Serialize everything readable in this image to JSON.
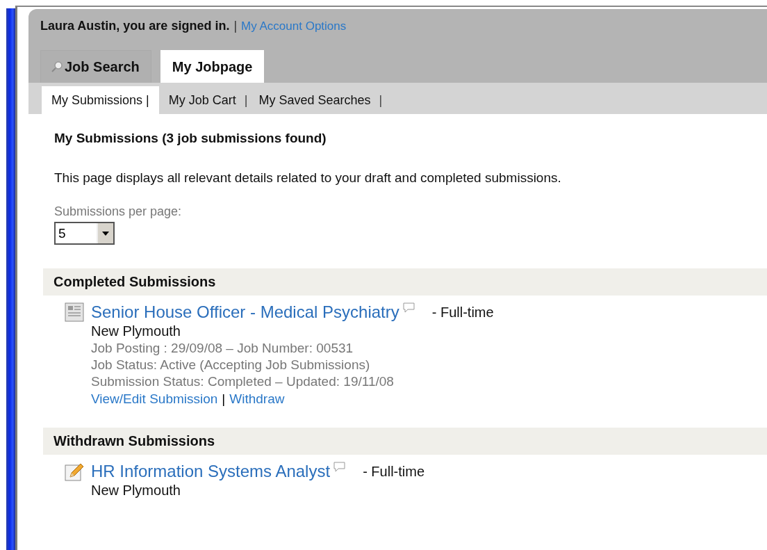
{
  "account": {
    "user_text": "Laura Austin, you are signed in.",
    "separator": "|",
    "link": "My Account Options"
  },
  "tabs": [
    {
      "label": "Job Search",
      "kind": "search",
      "selected": false
    },
    {
      "label": "My Jobpage",
      "kind": "plain",
      "selected": true
    }
  ],
  "subtabs": [
    {
      "label": "My Submissions",
      "separator": "|",
      "selected": true
    },
    {
      "label": "My Job Cart",
      "separator": "|",
      "selected": false
    },
    {
      "label": "My Saved Searches",
      "separator": "|",
      "selected": false
    }
  ],
  "heading": "My Submissions (3 job submissions found)",
  "intro": "This page displays all relevant details related to your draft and completed submissions.",
  "per_page": {
    "label": "Submissions per page:",
    "value": "5"
  },
  "sections": [
    {
      "title": "Completed Submissions",
      "jobs": [
        {
          "kind": "document",
          "title": "Senior House Officer - Medical Psychiatry",
          "type": "-  Full-time",
          "location": "New Plymouth",
          "details": [
            "Job Posting : 29/09/08 – Job Number: 00531",
            "Job Status: Active (Accepting Job Submissions)",
            "Submission Status: Completed – Updated: 19/11/08"
          ],
          "actions": [
            "View/Edit Submission",
            "Withdraw"
          ],
          "action_separator": "|"
        }
      ]
    },
    {
      "title": "Withdrawn Submissions",
      "jobs": [
        {
          "kind": "pencil",
          "title": "HR Information Systems Analyst",
          "type": "-  Full-time",
          "location": "New Plymouth"
        }
      ]
    }
  ]
}
